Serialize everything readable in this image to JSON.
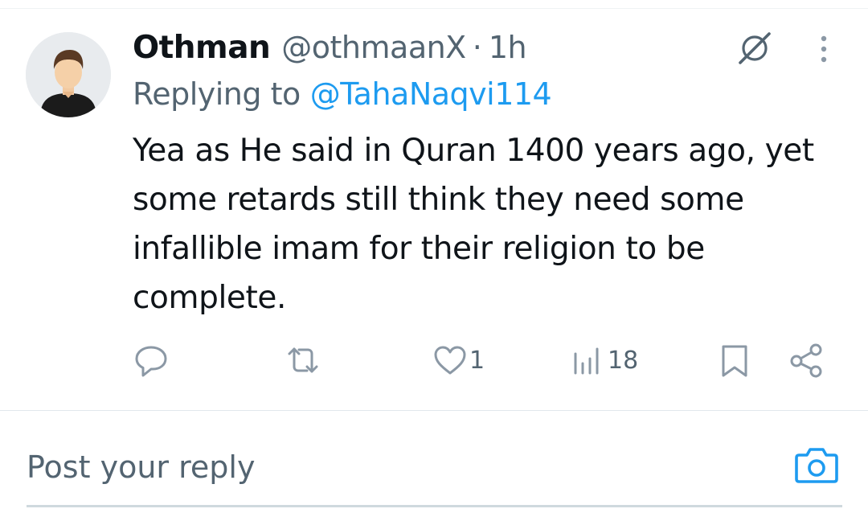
{
  "tweet": {
    "author": {
      "display_name": "Othman",
      "handle": "@othmaanX",
      "separator": "·",
      "time": "1h",
      "avatar": "default-avatar-icon"
    },
    "replying_to": {
      "prefix": "Replying to",
      "handle": "@TahaNaqvi114"
    },
    "text": "Yea as He said in Quran 1400 years ago, yet some retards still think they need some infallible imam for their religion to be complete.",
    "actions": {
      "reply": {
        "icon": "reply-icon",
        "count": ""
      },
      "repost": {
        "icon": "repost-icon",
        "count": ""
      },
      "like": {
        "icon": "heart-icon",
        "count": "1"
      },
      "views": {
        "icon": "views-chart-icon",
        "count": "18"
      },
      "bookmark": {
        "icon": "bookmark-icon"
      },
      "share": {
        "icon": "share-icon"
      }
    },
    "header_icons": [
      "grok-icon",
      "more-options-icon"
    ]
  },
  "reply_box": {
    "placeholder": "Post your reply",
    "camera_icon": "camera-icon"
  },
  "colors": {
    "text": "#0f1419",
    "secondary": "#536471",
    "accent": "#1d9bf0",
    "divider": "#e1e8ed"
  }
}
